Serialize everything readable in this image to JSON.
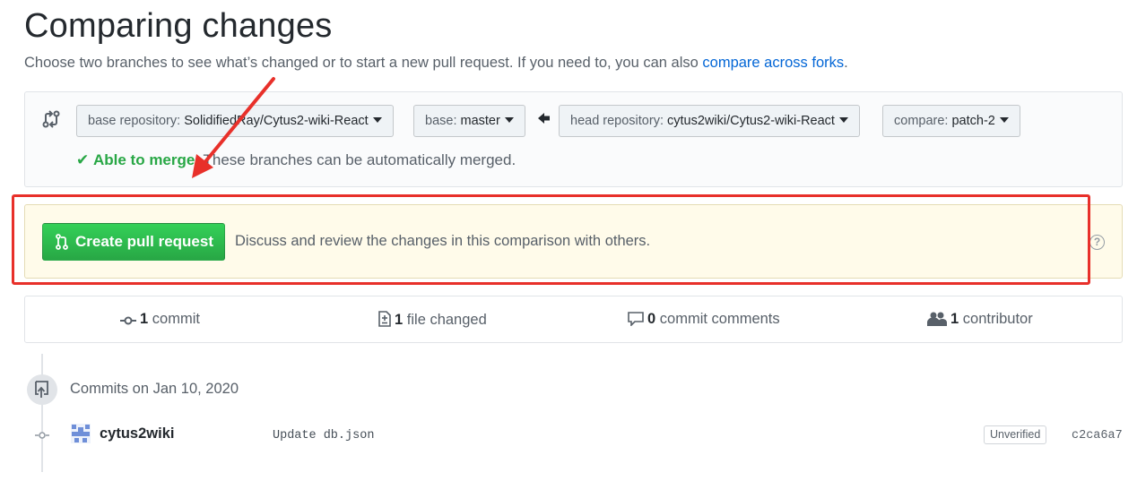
{
  "header": {
    "title": "Comparing changes",
    "subtitle_text": "Choose two branches to see what’s changed or to start a new pull request. If you need to, you can also ",
    "subtitle_link": "compare across forks",
    "subtitle_end": "."
  },
  "range": {
    "base_repo_key": "base repository: ",
    "base_repo_value": "SolidifiedRay/Cytus2-wiki-React",
    "base_key": "base: ",
    "base_value": "master",
    "head_repo_key": "head repository: ",
    "head_repo_value": "cytus2wiki/Cytus2-wiki-React",
    "compare_key": "compare: ",
    "compare_value": "patch-2",
    "merge_check": "✔",
    "merge_label": "Able to merge.",
    "merge_desc": " These branches can be automatically merged."
  },
  "pull_request": {
    "button_label": "Create pull request",
    "description": "Discuss and review the changes in this comparison with others.",
    "help": "?"
  },
  "stats": {
    "commits_count": "1",
    "commits_label": " commit",
    "files_count": "1",
    "files_label": " file changed",
    "comments_count": "0",
    "comments_label": " commit comments",
    "contributors_count": "1",
    "contributors_label": " contributor"
  },
  "commits": {
    "day_label": "Commits on Jan 10, 2020",
    "items": [
      {
        "author": "cytus2wiki",
        "message": "Update db.json",
        "badge": "Unverified",
        "sha": "c2ca6a7"
      }
    ]
  },
  "colors": {
    "accent_green": "#28a745",
    "link_blue": "#0366d6",
    "annotation_red": "#e8302a",
    "pr_box_bg": "#fffbea"
  }
}
